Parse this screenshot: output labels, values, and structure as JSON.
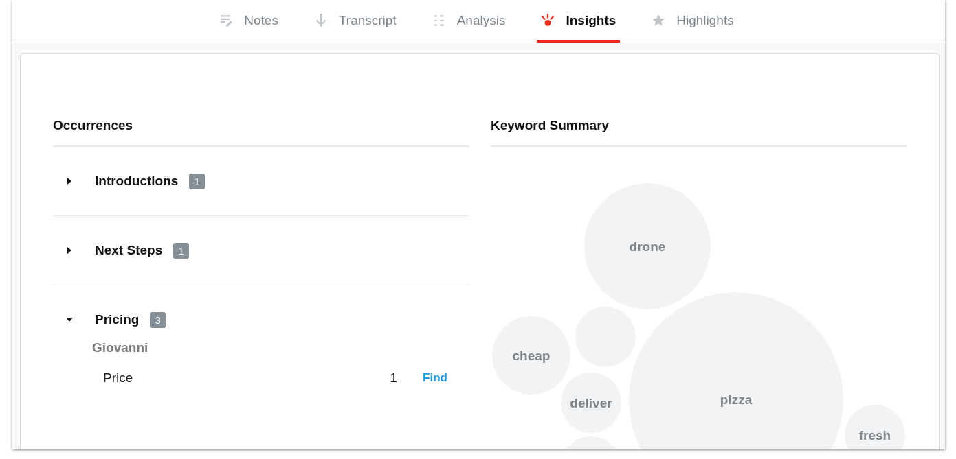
{
  "tabs": [
    {
      "label": "Notes",
      "kind": "notes",
      "selected": false
    },
    {
      "label": "Transcript",
      "kind": "mic",
      "selected": false
    },
    {
      "label": "Analysis",
      "kind": "list",
      "selected": false
    },
    {
      "label": "Insights",
      "kind": "spark",
      "selected": true
    },
    {
      "label": "Highlights",
      "kind": "star",
      "selected": false
    }
  ],
  "occurrences": {
    "title": "Occurrences",
    "sections": [
      {
        "label": "Introductions",
        "count": "1",
        "expanded": false
      },
      {
        "label": "Next Steps",
        "count": "1",
        "expanded": false
      },
      {
        "label": "Pricing",
        "count": "3",
        "expanded": true,
        "speakers": [
          {
            "name": "Giovanni",
            "items": [
              {
                "term": "Price",
                "count": "1",
                "action": "Find"
              }
            ]
          }
        ]
      }
    ]
  },
  "keyword_summary": {
    "title": "Keyword Summary",
    "bubbles": [
      {
        "label": "drone"
      },
      {
        "label": "cheap"
      },
      {
        "label": "deliver"
      },
      {
        "label": "pizza"
      },
      {
        "label": "fresh"
      }
    ]
  }
}
